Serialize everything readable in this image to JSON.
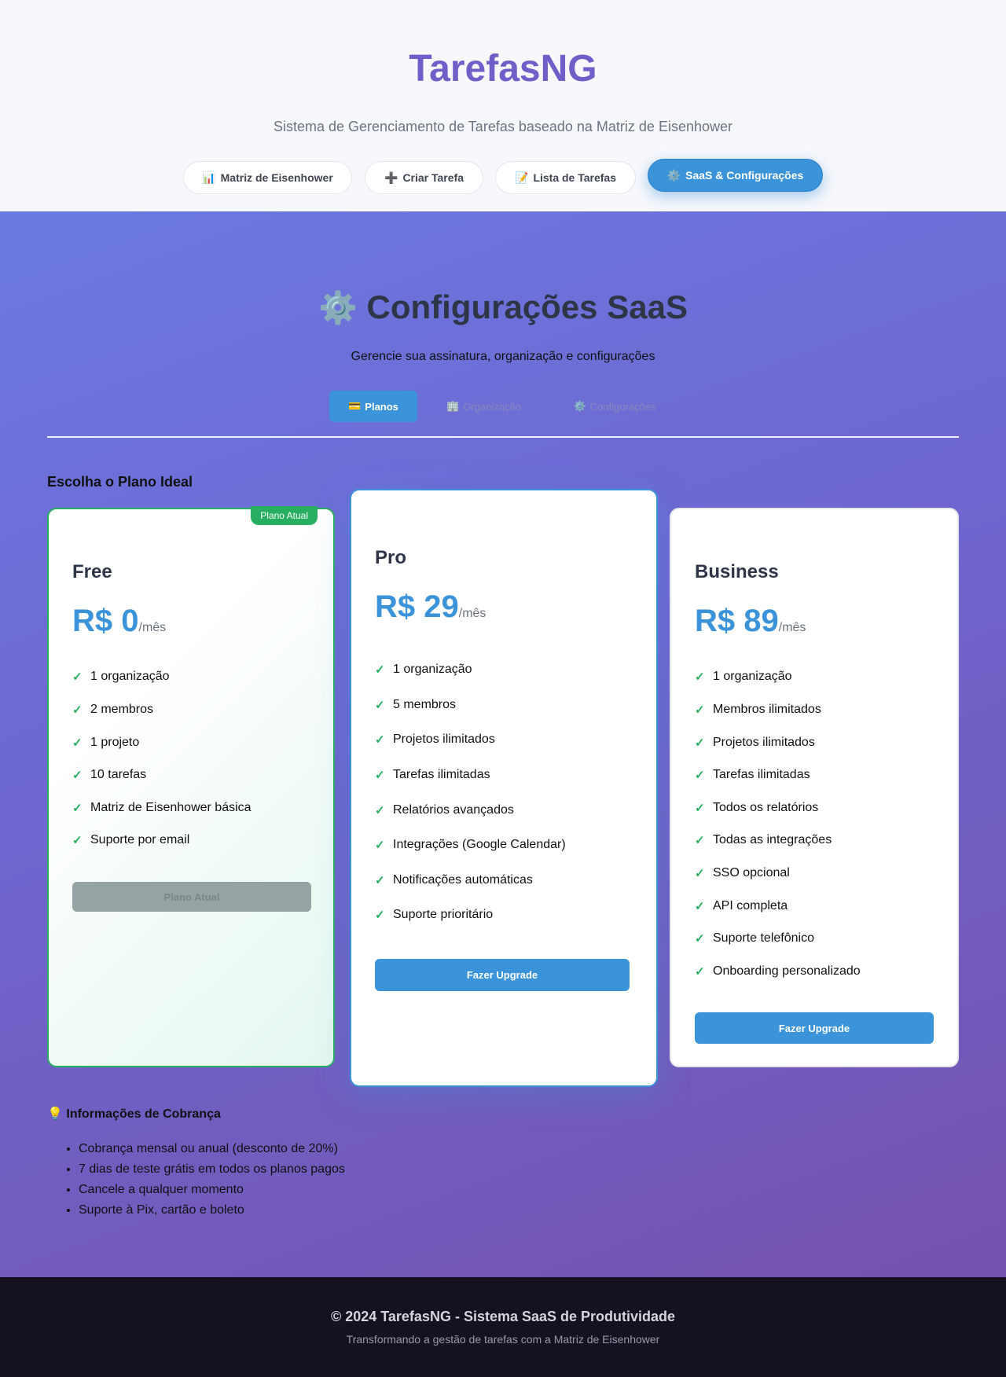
{
  "header": {
    "brand": "TarefasNG",
    "tagline": "Sistema de Gerenciamento de Tarefas baseado na Matriz de Eisenhower",
    "nav": [
      {
        "icon": "📊",
        "icon_name": "chart-icon",
        "label": "Matriz de Eisenhower",
        "active": false
      },
      {
        "icon": "➕",
        "icon_name": "plus-icon",
        "label": "Criar Tarefa",
        "active": false
      },
      {
        "icon": "📝",
        "icon_name": "memo-icon",
        "label": "Lista de Tarefas",
        "active": false
      },
      {
        "icon": "⚙️",
        "icon_name": "gear-icon",
        "label": "SaaS & Configurações",
        "active": true
      }
    ]
  },
  "main": {
    "title_icon": "⚙️",
    "title": "Configurações SaaS",
    "subtitle": "Gerencie sua assinatura, organização e configurações",
    "tabs": [
      {
        "icon": "💳",
        "icon_name": "credit-card-icon",
        "label": "Planos",
        "active": true
      },
      {
        "icon": "🏢",
        "icon_name": "building-icon",
        "label": "Organização",
        "active": false
      },
      {
        "icon": "⚙️",
        "icon_name": "gear-icon",
        "label": "Configurações",
        "active": false
      }
    ],
    "section_title": "Escolha o Plano Ideal",
    "plans": [
      {
        "name": "Free",
        "price": "R$ 0",
        "period": "/mês",
        "badge": "Plano Atual",
        "features": [
          "1 organização",
          "2 membros",
          "1 projeto",
          "10 tarefas",
          "Matriz de Eisenhower básica",
          "Suporte por email"
        ],
        "button": "Plano Atual"
      },
      {
        "name": "Pro",
        "price": "R$ 29",
        "period": "/mês",
        "features": [
          "1 organização",
          "5 membros",
          "Projetos ilimitados",
          "Tarefas ilimitadas",
          "Relatórios avançados",
          "Integrações (Google Calendar)",
          "Notificações automáticas",
          "Suporte prioritário"
        ],
        "button": "Fazer Upgrade"
      },
      {
        "name": "Business",
        "price": "R$ 89",
        "period": "/mês",
        "features": [
          "1 organização",
          "Membros ilimitados",
          "Projetos ilimitados",
          "Tarefas ilimitadas",
          "Todos os relatórios",
          "Todas as integrações",
          "SSO opcional",
          "API completa",
          "Suporte telefônico",
          "Onboarding personalizado"
        ],
        "button": "Fazer Upgrade"
      }
    ],
    "billing": {
      "icon": "💡",
      "title": "Informações de Cobrança",
      "items": [
        "Cobrança mensal ou anual (desconto de 20%)",
        "7 dias de teste grátis em todos os planos pagos",
        "Cancele a qualquer momento",
        "Suporte à Pix, cartão e boleto"
      ]
    }
  },
  "footer": {
    "title": "© 2024 TarefasNG - Sistema SaaS de Produtividade",
    "subtitle": "Transformando a gestão de tarefas com a Matriz de Eisenhower"
  },
  "colors": {
    "brand": "#6f5fc8",
    "accent": "#3b93d9",
    "success": "#27ae60",
    "footer_bg": "#161121"
  }
}
